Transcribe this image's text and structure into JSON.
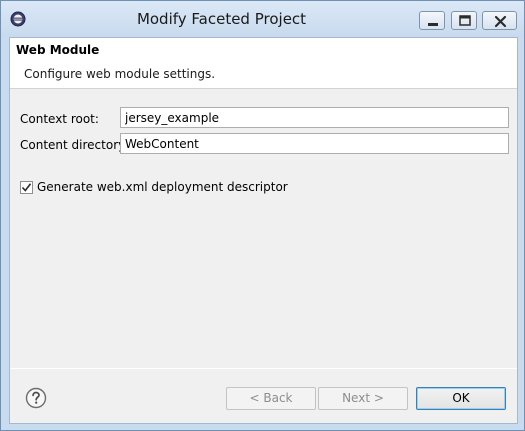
{
  "window": {
    "title": "Modify Faceted Project",
    "app_icon": "eclipse-icon",
    "controls": [
      "minimize-icon",
      "maximize-icon",
      "close-icon"
    ]
  },
  "banner": {
    "title": "Web Module",
    "description": "Configure web module settings."
  },
  "form": {
    "context_root": {
      "label": "Context root:",
      "value": "jersey_example"
    },
    "content_directory": {
      "label": "Content directory:",
      "value": "WebContent"
    },
    "generate_descriptor": {
      "label": "Generate web.xml deployment descriptor",
      "checked": true
    }
  },
  "footer": {
    "help_icon": "help-icon",
    "back_label": "< Back",
    "next_label": "Next >",
    "ok_label": "OK",
    "back_enabled": false,
    "next_enabled": false
  },
  "colors": {
    "titlebar": "#c8daee",
    "client_background": "#f0f0f0",
    "banner_background": "#ffffff",
    "default_button_border": "#3c7fb1"
  }
}
